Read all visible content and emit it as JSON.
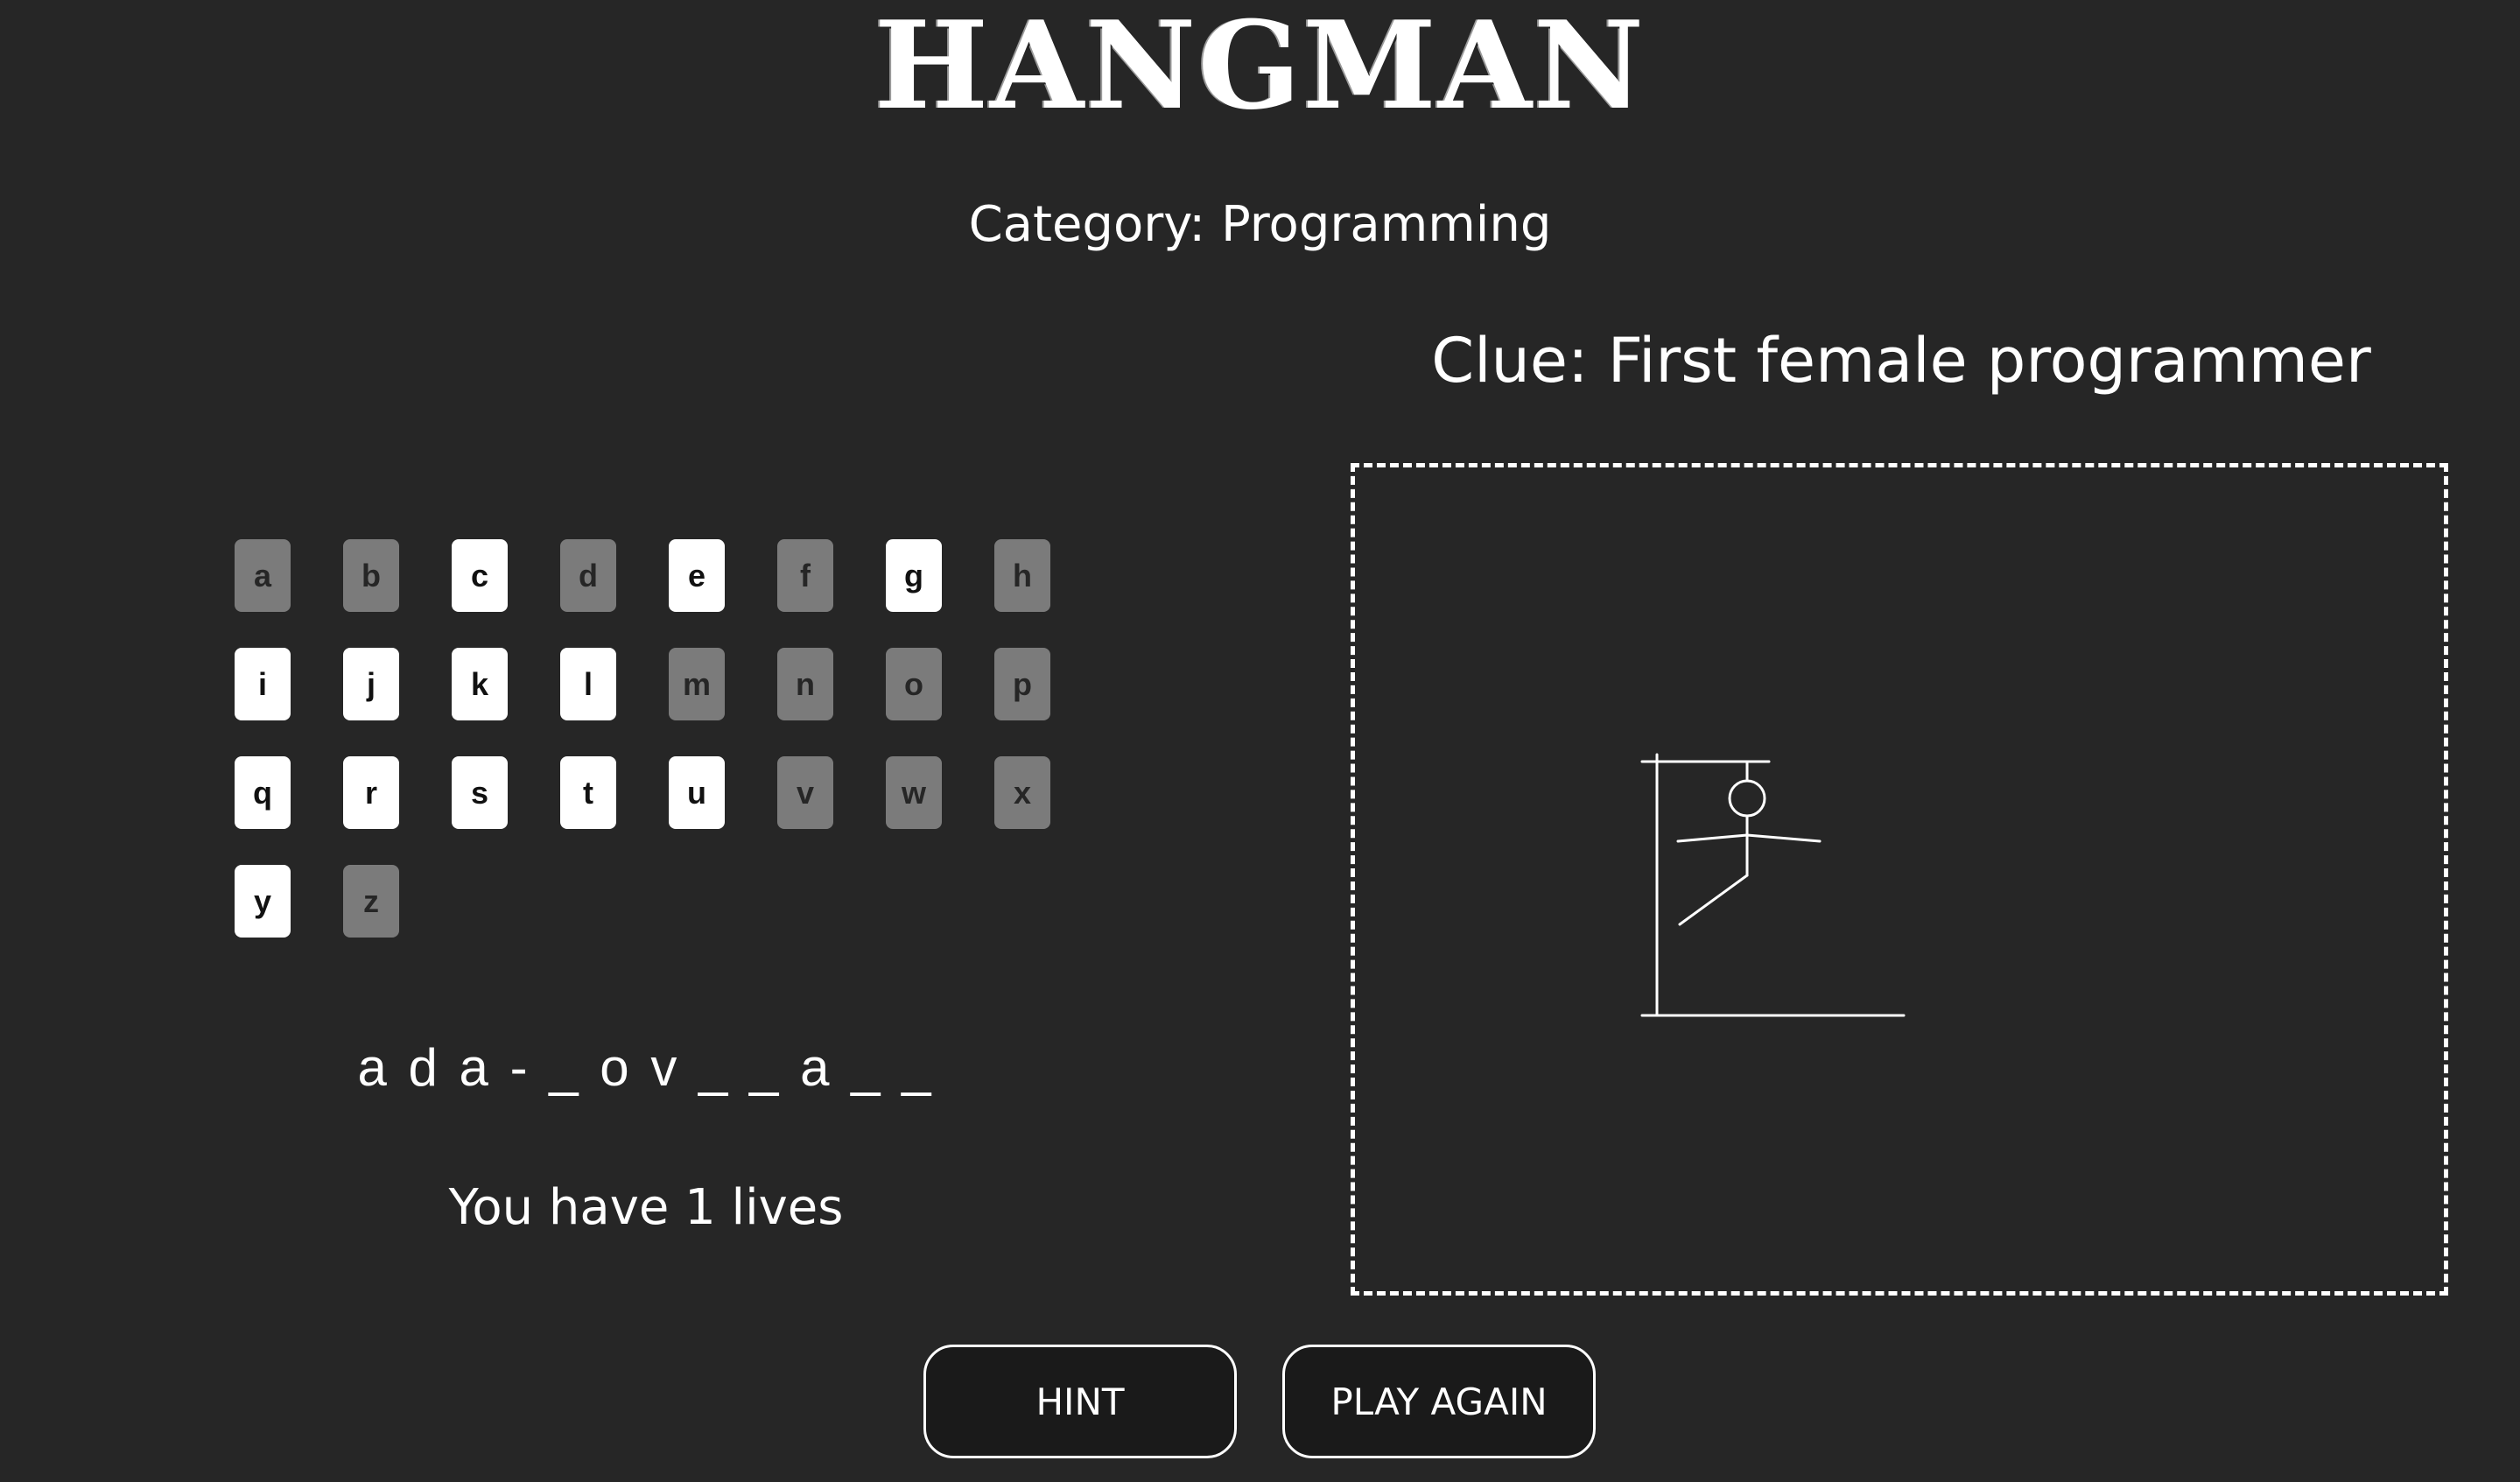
{
  "game": {
    "title": "HANGMAN",
    "category_text": "Category: Programming",
    "clue_text": "Clue: First female programmer",
    "word_display": "a d a - _ o v _ _ a _ _",
    "lives_text": "You have 1 lives",
    "lives": 1
  },
  "keyboard": {
    "keys": [
      {
        "letter": "a",
        "state": "used"
      },
      {
        "letter": "b",
        "state": "used"
      },
      {
        "letter": "c",
        "state": "available"
      },
      {
        "letter": "d",
        "state": "used"
      },
      {
        "letter": "e",
        "state": "available"
      },
      {
        "letter": "f",
        "state": "used"
      },
      {
        "letter": "g",
        "state": "available"
      },
      {
        "letter": "h",
        "state": "used"
      },
      {
        "letter": "i",
        "state": "available"
      },
      {
        "letter": "j",
        "state": "available"
      },
      {
        "letter": "k",
        "state": "available"
      },
      {
        "letter": "l",
        "state": "available"
      },
      {
        "letter": "m",
        "state": "used"
      },
      {
        "letter": "n",
        "state": "used"
      },
      {
        "letter": "o",
        "state": "used"
      },
      {
        "letter": "p",
        "state": "used"
      },
      {
        "letter": "q",
        "state": "available"
      },
      {
        "letter": "r",
        "state": "available"
      },
      {
        "letter": "s",
        "state": "available"
      },
      {
        "letter": "t",
        "state": "available"
      },
      {
        "letter": "u",
        "state": "available"
      },
      {
        "letter": "v",
        "state": "used"
      },
      {
        "letter": "w",
        "state": "used"
      },
      {
        "letter": "x",
        "state": "used"
      },
      {
        "letter": "y",
        "state": "available"
      },
      {
        "letter": "z",
        "state": "used"
      }
    ]
  },
  "drawing": {
    "parts_shown": [
      "base",
      "pole",
      "beam",
      "rope",
      "head",
      "body",
      "left-arm",
      "right-arm",
      "left-leg"
    ]
  },
  "buttons": {
    "hint_label": "HINT",
    "play_again_label": "PLAY AGAIN"
  },
  "colors": {
    "background": "#262626",
    "key_available": "#ffffff",
    "key_used": "#7b7b7b",
    "button_background": "#1a1a1a"
  }
}
